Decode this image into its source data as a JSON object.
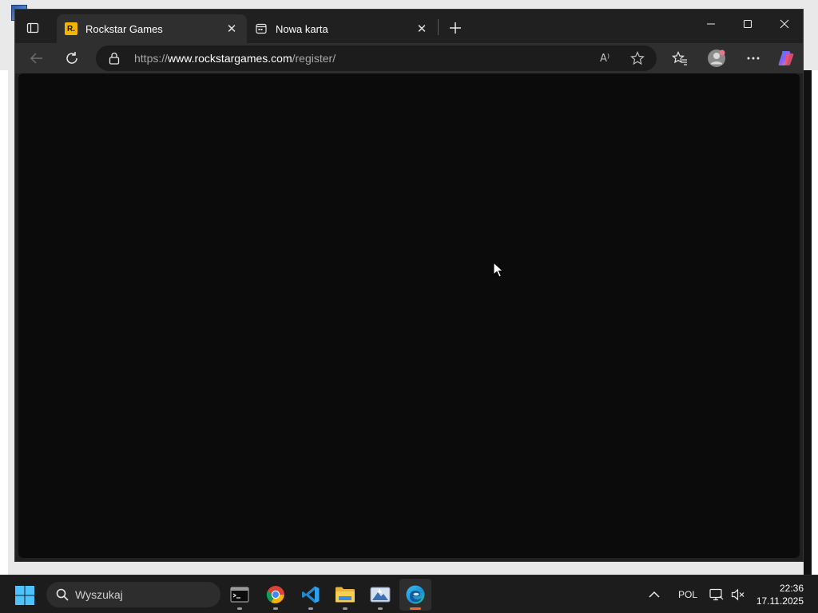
{
  "browser": {
    "tabs": [
      {
        "title": "Rockstar Games",
        "favicon": "rockstar-favicon",
        "favicon_letter": "R.",
        "active": true
      },
      {
        "title": "Nowa karta",
        "favicon": "new-tab-favicon",
        "active": false
      }
    ],
    "address": {
      "scheme": "https://",
      "domain": "www.rockstargames.com",
      "path": "/register/"
    },
    "read_aloud_glyph": "A⁾"
  },
  "page": {
    "background": "#0b0b0b"
  },
  "taskbar": {
    "search_placeholder": "Wyszukaj",
    "apps": [
      "terminal-icon",
      "chrome-icon",
      "vscode-icon",
      "file-explorer-icon",
      "photos-icon",
      "edge-icon"
    ],
    "tray": {
      "language": "POL"
    },
    "clock": {
      "time": "22:36",
      "date": "17.11.2025"
    }
  },
  "colors": {
    "accent_edge": "#f06a2c",
    "rockstar_yellow": "#f4b400"
  }
}
